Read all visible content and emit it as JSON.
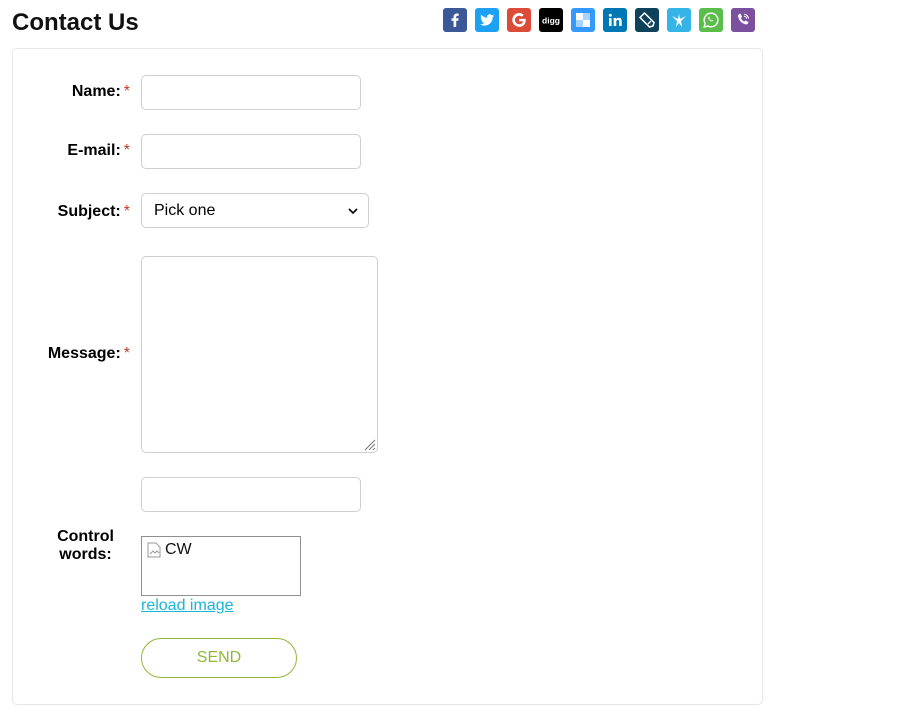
{
  "page": {
    "title": "Contact Us"
  },
  "share": {
    "buttons": [
      {
        "icon": "facebook-icon",
        "color": "#3b5998"
      },
      {
        "icon": "twitter-icon",
        "color": "#1da1f2"
      },
      {
        "icon": "google-icon",
        "color": "#dd4b39"
      },
      {
        "icon": "digg-icon",
        "color": "#000000",
        "text": "digg"
      },
      {
        "icon": "delicious-icon",
        "color": "#3399ff"
      },
      {
        "icon": "linkedin-icon",
        "color": "#0077b5"
      },
      {
        "icon": "livejournal-icon",
        "color": "#0d425a"
      },
      {
        "icon": "tumblr-bird-icon",
        "color": "#35b4e8"
      },
      {
        "icon": "whatsapp-icon",
        "color": "#5cbe4a"
      },
      {
        "icon": "viber-icon",
        "color": "#7b519d"
      }
    ]
  },
  "form": {
    "required_mark": "*",
    "name_label": "Name:",
    "name_value": "",
    "email_label": "E-mail:",
    "email_value": "",
    "subject_label": "Subject:",
    "subject_selected": "Pick one",
    "message_label": "Message:",
    "message_value": "",
    "extra_value": "",
    "captcha_label": "Control words:",
    "captcha_alt": "CW",
    "captcha_value": "",
    "reload_link": "reload image",
    "send_label": "SEND"
  },
  "colors": {
    "required": "#c0392b",
    "link": "#18b6d6",
    "send": "#8fb83a"
  }
}
